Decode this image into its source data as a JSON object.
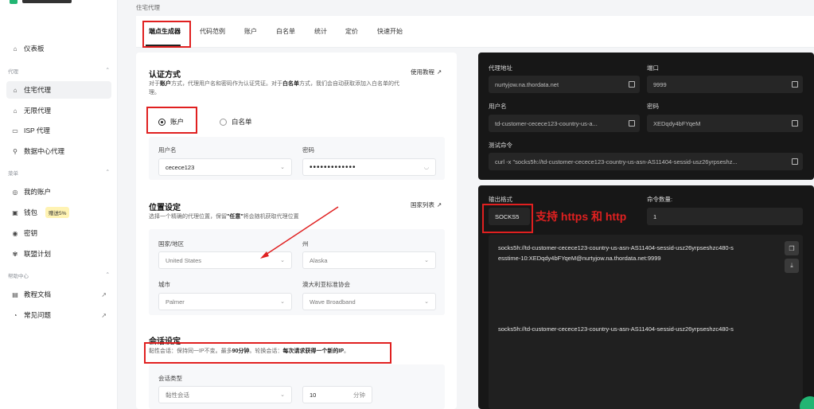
{
  "breadcrumb": "住宅代理",
  "sidebar": {
    "dashboard": "仪表板",
    "section_proxy": "代理",
    "items_proxy": [
      "住宅代理",
      "无限代理",
      "ISP 代理",
      "数据中心代理"
    ],
    "section_menu": "菜单",
    "items_menu": [
      "我的账户",
      "钱包",
      "密钥",
      "联盟计划"
    ],
    "wallet_badge": "赠送5%",
    "section_help": "帮助中心",
    "items_help": [
      "教程文档",
      "常见问题"
    ]
  },
  "tabs": [
    "端点生成器",
    "代码范例",
    "账户",
    "白名单",
    "统计",
    "定价",
    "快速开始"
  ],
  "auth": {
    "title": "认证方式",
    "link": "使用教程",
    "desc_1": "对于",
    "desc_b1": "账户",
    "desc_2": "方式，代理用户名和密码作为认证凭证。对于",
    "desc_b2": "白名单",
    "desc_3": "方式，我们会自动获取添加入白名单的代",
    "desc_4": "理。",
    "opt_account": "账户",
    "opt_whitelist": "白名单",
    "username_label": "用户名",
    "username_value": "cecece123",
    "password_label": "密码",
    "password_value": "•••••••••••••"
  },
  "location": {
    "title": "位置设定",
    "link": "国家列表",
    "desc_1": "选择一个精确的代理位置，保留",
    "desc_b": "\"任意\"",
    "desc_2": "将会随机获取代理位置",
    "country_label": "国家/地区",
    "country_value": "United States",
    "state_label": "州",
    "state_value": "Alaska",
    "city_label": "城市",
    "city_value": "Palmer",
    "asn_label": "澳大利亚标准协会",
    "asn_value": "Wave Broadband"
  },
  "session": {
    "title": "会话设定",
    "desc_1": "黏性会话：保持同一IP不变。最多",
    "desc_b1": "90分钟",
    "desc_2": "。轮换会话：",
    "desc_b2": "每次请求获得一个新的IP",
    "desc_3": "。",
    "type_label": "会话类型",
    "type_value": "黏性会话",
    "minutes_value": "10",
    "minutes_unit": "分钟"
  },
  "endpoint": {
    "host_label": "代理地址",
    "host_value": "nurtyjow.na.thordata.net",
    "port_label": "端口",
    "port_value": "9999",
    "user_label": "用户名",
    "user_value": "td-customer-cecece123-country-us-a...",
    "pass_label": "密码",
    "pass_value": "XEDqdy4bFYqeM",
    "test_label": "测试命令",
    "test_value": "curl -x \"socks5h://td-customer-cecece123-country-us-asn-AS11404-sessid-usz26yrpseshz..."
  },
  "output": {
    "format_label": "输出格式",
    "format_value": "SOCKS5",
    "count_label": "命令数量:",
    "count_value": "1",
    "command_line1": "socks5h://td-customer-cecece123-country-us-asn-AS11404-sessid-usz26yrpseshzc480-s",
    "command_line2": "esstime-10:XEDqdy4bFYqeM@nurtyjow.na.thordata.net:9999",
    "command_line3": "socks5h://td-customer-cecece123-country-us-asn-AS11404-sessid-usz26yrpseshzc480-s"
  },
  "annotation": "支持 https 和 http"
}
